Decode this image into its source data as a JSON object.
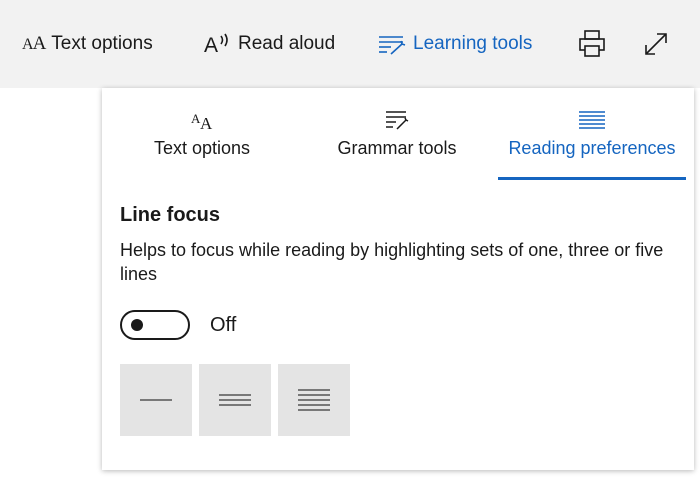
{
  "toolbar": {
    "text_options": "Text options",
    "read_aloud": "Read aloud",
    "learning_tools": "Learning tools",
    "print_icon": "printer-icon",
    "fullscreen_icon": "expand-icon"
  },
  "tabs": [
    {
      "label": "Text options",
      "icon": "text-size-icon"
    },
    {
      "label": "Grammar tools",
      "icon": "grammar-icon"
    },
    {
      "label": "Reading preferences",
      "icon": "lines-icon",
      "active": true
    }
  ],
  "section": {
    "title": "Line focus",
    "description": "Helps to focus while reading by highlighting sets of one, three or five lines"
  },
  "toggle": {
    "state": "Off",
    "on": false
  },
  "line_options": [
    "one-line-icon",
    "three-lines-icon",
    "five-lines-icon"
  ],
  "colors": {
    "accent": "#1565c0",
    "toolbar_bg": "#f2f2f2",
    "button_bg": "#e4e4e4"
  }
}
